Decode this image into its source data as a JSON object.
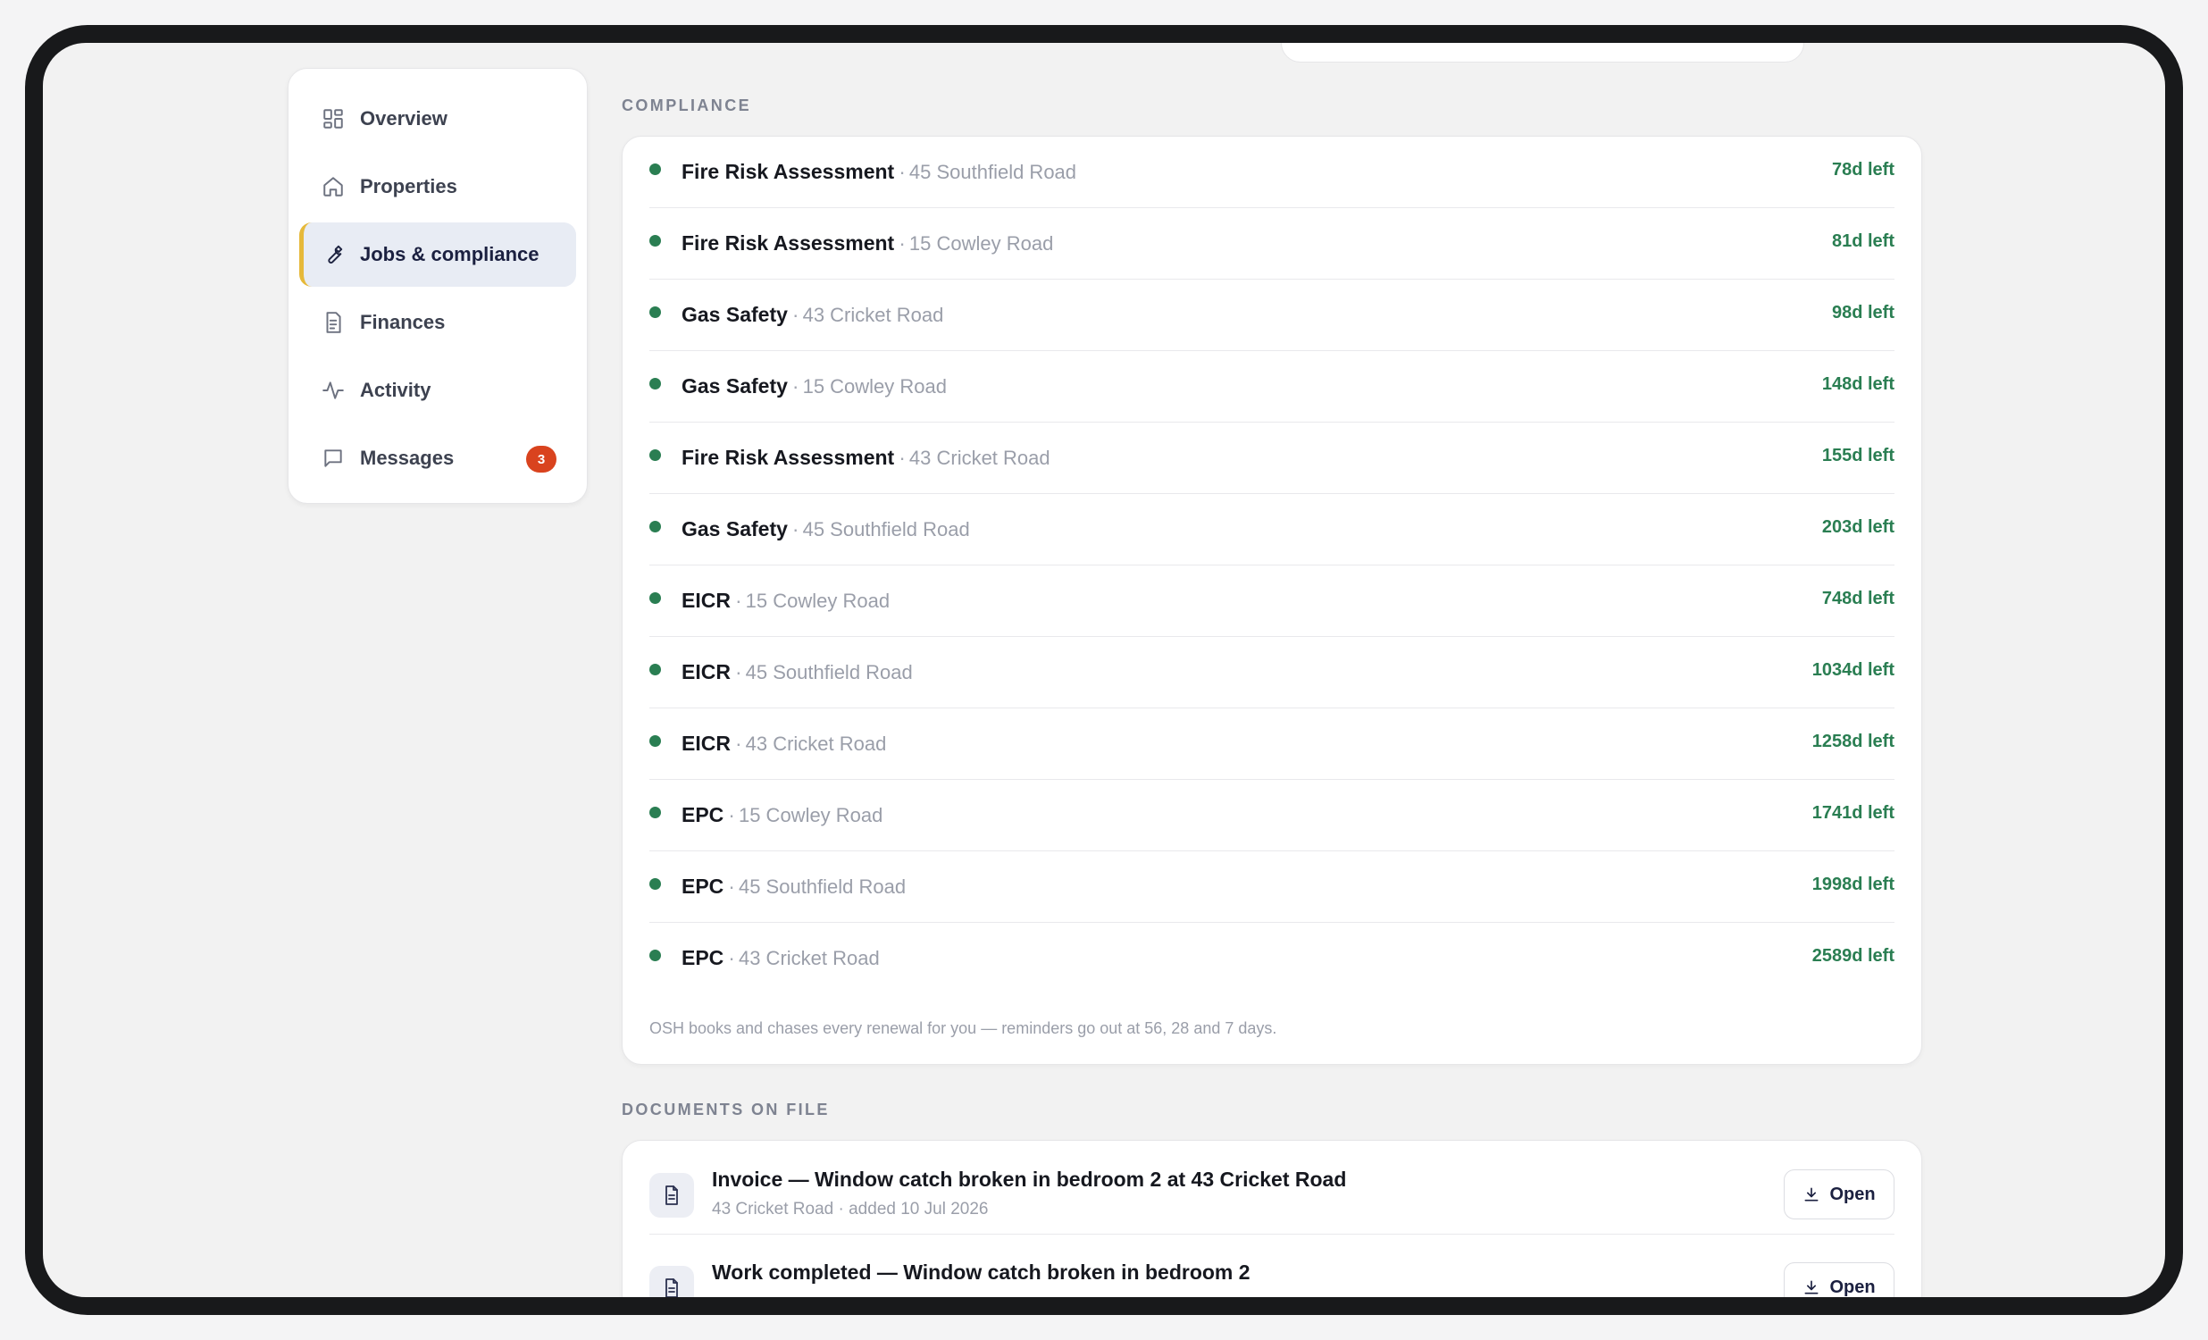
{
  "sidebar": {
    "items": [
      {
        "label": "Overview",
        "icon": "grid-icon",
        "active": false
      },
      {
        "label": "Properties",
        "icon": "home-icon",
        "active": false
      },
      {
        "label": "Jobs & compliance",
        "icon": "wrench-icon",
        "active": true
      },
      {
        "label": "Finances",
        "icon": "receipt-icon",
        "active": false
      },
      {
        "label": "Activity",
        "icon": "activity-icon",
        "active": false
      },
      {
        "label": "Messages",
        "icon": "message-icon",
        "active": false,
        "badge": "3"
      }
    ]
  },
  "compliance": {
    "heading": "COMPLIANCE",
    "items": [
      {
        "title": "Fire Risk Assessment",
        "address": "45 Southfield Road",
        "days": "78d left"
      },
      {
        "title": "Fire Risk Assessment",
        "address": "15 Cowley Road",
        "days": "81d left"
      },
      {
        "title": "Gas Safety",
        "address": "43 Cricket Road",
        "days": "98d left"
      },
      {
        "title": "Gas Safety",
        "address": "15 Cowley Road",
        "days": "148d left"
      },
      {
        "title": "Fire Risk Assessment",
        "address": "43 Cricket Road",
        "days": "155d left"
      },
      {
        "title": "Gas Safety",
        "address": "45 Southfield Road",
        "days": "203d left"
      },
      {
        "title": "EICR",
        "address": "15 Cowley Road",
        "days": "748d left"
      },
      {
        "title": "EICR",
        "address": "45 Southfield Road",
        "days": "1034d left"
      },
      {
        "title": "EICR",
        "address": "43 Cricket Road",
        "days": "1258d left"
      },
      {
        "title": "EPC",
        "address": "15 Cowley Road",
        "days": "1741d left"
      },
      {
        "title": "EPC",
        "address": "45 Southfield Road",
        "days": "1998d left"
      },
      {
        "title": "EPC",
        "address": "43 Cricket Road",
        "days": "2589d left"
      }
    ],
    "separator": "·",
    "note": "OSH books and chases every renewal for you — reminders go out at 56, 28 and 7 days.",
    "status_color": "#2a7e52"
  },
  "documents": {
    "heading": "DOCUMENTS ON FILE",
    "items": [
      {
        "title": "Invoice — Window catch broken in bedroom 2 at 43 Cricket Road",
        "meta": "43 Cricket Road · added 10 Jul 2026",
        "button": "Open"
      },
      {
        "title": "Work completed — Window catch broken in bedroom 2",
        "meta": "",
        "button": "Open"
      }
    ]
  },
  "colors": {
    "accent": "#e6b93a",
    "badge": "#d9431e",
    "active_bg": "#e8ecf4"
  }
}
